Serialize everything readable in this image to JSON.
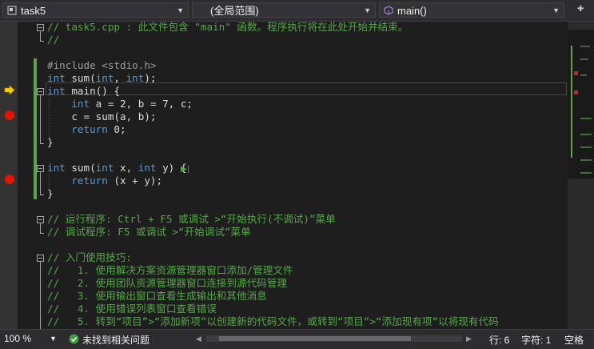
{
  "nav": {
    "project": "task5",
    "scope": "(全局范围)",
    "function": "main()"
  },
  "code": {
    "lines": [
      "// task5.cpp : 此文件包含 \"main\" 函数。程序执行将在此处开始并结束。",
      "//",
      "",
      "#include <stdio.h>",
      "int sum(int, int);",
      "int main() {",
      "    int a = 2, b = 7, c;",
      "    c = sum(a, b);",
      "    return 0;",
      "}",
      "",
      "int sum(int x, int y) {",
      "    return (x + y);",
      "}",
      "",
      "// 运行程序: Ctrl + F5 或调试 >“开始执行(不调试)”菜单",
      "// 调试程序: F5 或调试 >“开始调试”菜单",
      "",
      "// 入门使用技巧:",
      "//   1. 使用解决方案资源管理器窗口添加/管理文件",
      "//   2. 使用团队资源管理器窗口连接到源代码管理",
      "//   3. 使用输出窗口查看生成输出和其他消息",
      "//   4. 使用错误列表窗口查看错误",
      "//   5. 转到“项目”>“添加新项”以创建新的代码文件，或转到“项目”>“添加现有项”以将现有代码"
    ]
  },
  "status": {
    "zoom": "100 %",
    "issues": "未找到相关问题",
    "line": "行: 6",
    "char": "字符: 1",
    "mode": "空格"
  },
  "colors": {
    "keyword": "#569cd6",
    "comment": "#57a64a",
    "breakpoint": "#e51400",
    "arrow": "#ffcc00"
  }
}
